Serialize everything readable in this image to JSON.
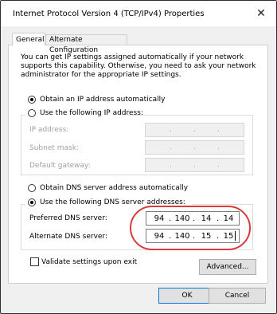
{
  "window": {
    "title": "Internet Protocol Version 4 (TCP/IPv4) Properties",
    "close_glyph": "✕"
  },
  "tabs": [
    {
      "label": "General"
    },
    {
      "label": "Alternate Configuration"
    }
  ],
  "description": "You can get IP settings assigned automatically if your network supports this capability. Otherwise, you need to ask your network administrator for the appropriate IP settings.",
  "ip_section": {
    "auto_label": "Obtain an IP address automatically",
    "manual_label": "Use the following IP address:",
    "fields": [
      {
        "label": "IP address:"
      },
      {
        "label": "Subnet mask:"
      },
      {
        "label": "Default gateway:"
      }
    ],
    "dot": "."
  },
  "dns_section": {
    "auto_label": "Obtain DNS server address automatically",
    "manual_label": "Use the following DNS server addresses:",
    "preferred": {
      "label": "Preferred DNS server:",
      "octets": [
        "94",
        "140",
        "14",
        "14"
      ]
    },
    "alternate": {
      "label": "Alternate DNS server:",
      "octets": [
        "94",
        "140",
        "15",
        "15"
      ]
    },
    "dot": "."
  },
  "validate_label": "Validate settings upon exit",
  "advanced_label": "Advanced...",
  "ok_label": "OK",
  "cancel_label": "Cancel",
  "colors": {
    "accent": "#0078d7",
    "highlight_circle": "#d93b3b"
  }
}
